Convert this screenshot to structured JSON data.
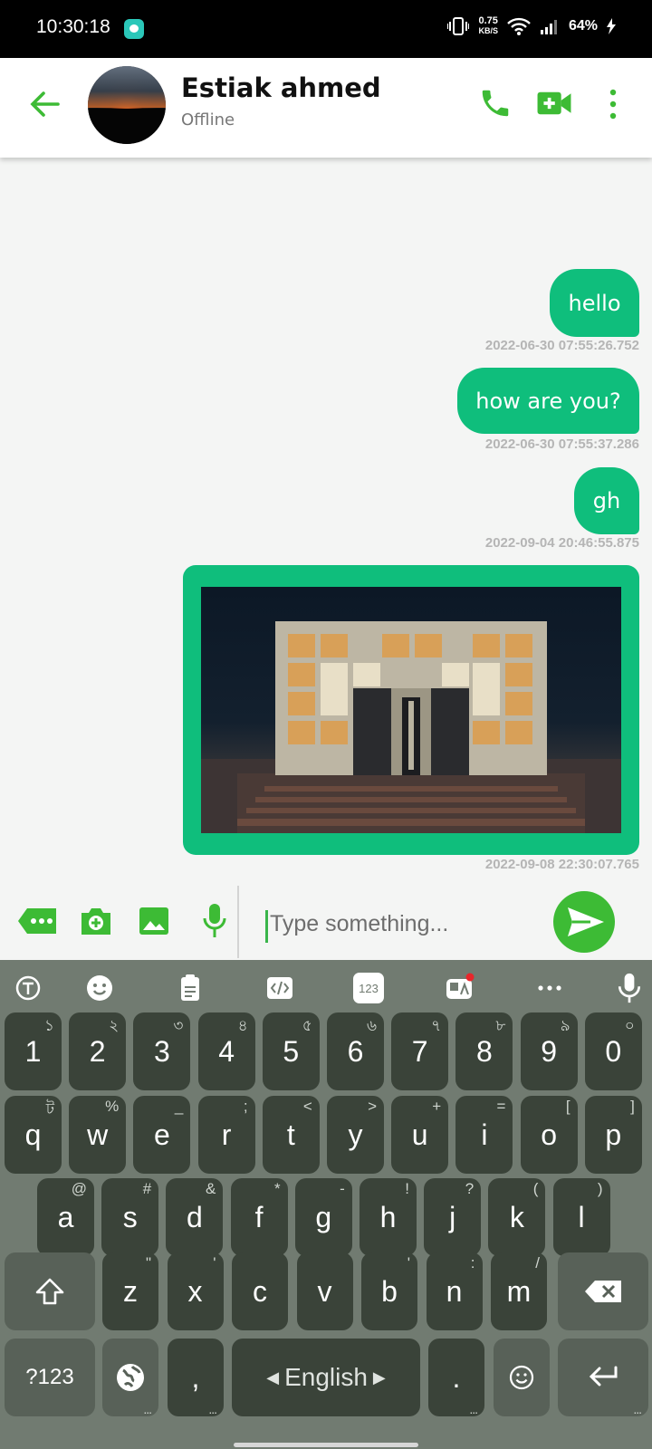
{
  "status_bar": {
    "time": "10:30:18",
    "net_speed_value": "0.75",
    "net_speed_unit": "KB/S",
    "battery": "64%"
  },
  "header": {
    "contact_name": "Estiak ahmed",
    "contact_status": "Offline",
    "accent_color": "#3dbb35"
  },
  "messages": [
    {
      "text": "hello",
      "timestamp": "2022-06-30 07:55:26.752"
    },
    {
      "text": "how are you?",
      "timestamp": "2022-06-30 07:55:37.286"
    },
    {
      "text": "gh",
      "timestamp": "2022-09-04 20:46:55.875"
    },
    {
      "type": "image",
      "timestamp": "2022-09-08 22:30:07.765"
    }
  ],
  "composer": {
    "placeholder": "Type something...",
    "icons": [
      "more-options-icon",
      "camera-icon",
      "gallery-icon",
      "microphone-icon",
      "send-icon"
    ]
  },
  "keyboard": {
    "toolbar_icons": [
      "text-correction-icon",
      "emoji-icon",
      "clipboard-icon",
      "text-edit-icon",
      "number-pad-icon",
      "translate-icon",
      "more-icon",
      "voice-input-icon"
    ],
    "number_pad_label": "123",
    "rows": [
      [
        [
          "1",
          "১"
        ],
        [
          "2",
          "২"
        ],
        [
          "3",
          "৩"
        ],
        [
          "4",
          "৪"
        ],
        [
          "5",
          "৫"
        ],
        [
          "6",
          "৬"
        ],
        [
          "7",
          "৭"
        ],
        [
          "8",
          "৮"
        ],
        [
          "9",
          "৯"
        ],
        [
          "0",
          "০"
        ]
      ],
      [
        [
          "q",
          "ট"
        ],
        [
          "w",
          "%"
        ],
        [
          "e",
          "_"
        ],
        [
          "r",
          ";"
        ],
        [
          "t",
          "<"
        ],
        [
          "y",
          ">"
        ],
        [
          "u",
          "+"
        ],
        [
          "i",
          "="
        ],
        [
          "o",
          "["
        ],
        [
          "p",
          "]"
        ]
      ],
      [
        [
          "a",
          "@"
        ],
        [
          "s",
          "#"
        ],
        [
          "d",
          "&"
        ],
        [
          "f",
          "*"
        ],
        [
          "g",
          "-"
        ],
        [
          "h",
          "!"
        ],
        [
          "j",
          "?"
        ],
        [
          "k",
          "("
        ],
        [
          "l",
          ")"
        ]
      ],
      [
        [
          "z",
          "\""
        ],
        [
          "x",
          "'"
        ],
        [
          "c",
          ""
        ],
        [
          "v",
          ""
        ],
        [
          "b",
          "'"
        ],
        [
          "n",
          ":"
        ],
        [
          "m",
          "/"
        ]
      ]
    ],
    "symbols_label": "?123",
    "comma_label": ",",
    "space_label": "English",
    "period_label": "."
  }
}
